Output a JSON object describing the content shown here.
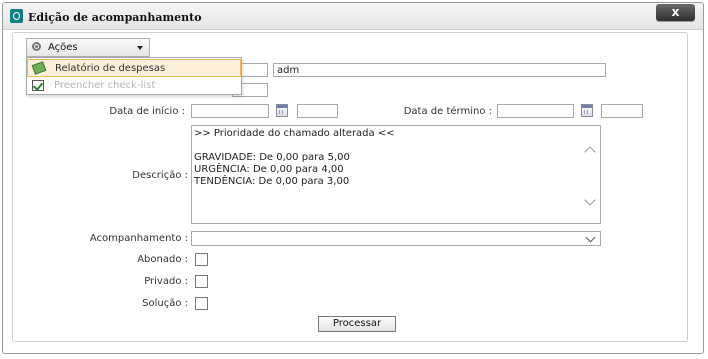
{
  "window": {
    "title": "Edição de acompanhamento",
    "close_label": "x"
  },
  "actions_menu": {
    "button_label": "Ações",
    "items": [
      {
        "label": "Relatório de despesas",
        "icon": "money-icon",
        "state": "highlighted"
      },
      {
        "label": "Preencher check-list",
        "icon": "checklist-icon",
        "state": "disabled"
      }
    ]
  },
  "form": {
    "user_value": "adm",
    "start_date_label": "Data de início :",
    "end_date_label": "Data de término :",
    "description_label": "Descrição :",
    "description_lines": [
      ">> Prioridade do chamado alterada <<",
      "",
      "GRAVIDADE: De 0,00 para 5,00",
      "URGÊNCIA: De 0,00 para 4,00",
      "TENDÊNCIA: De 0,00 para 3,00"
    ],
    "followup_label": "Acompanhamento :",
    "followup_value": "",
    "abonado_label": "Abonado :",
    "privado_label": "Privado :",
    "solucao_label": "Solução :",
    "submit_label": "Processar"
  },
  "colors": {
    "menu_highlight_bg": "#fbefd9",
    "menu_highlight_border": "#f0b85a",
    "app_icon": "#0f7f86"
  }
}
